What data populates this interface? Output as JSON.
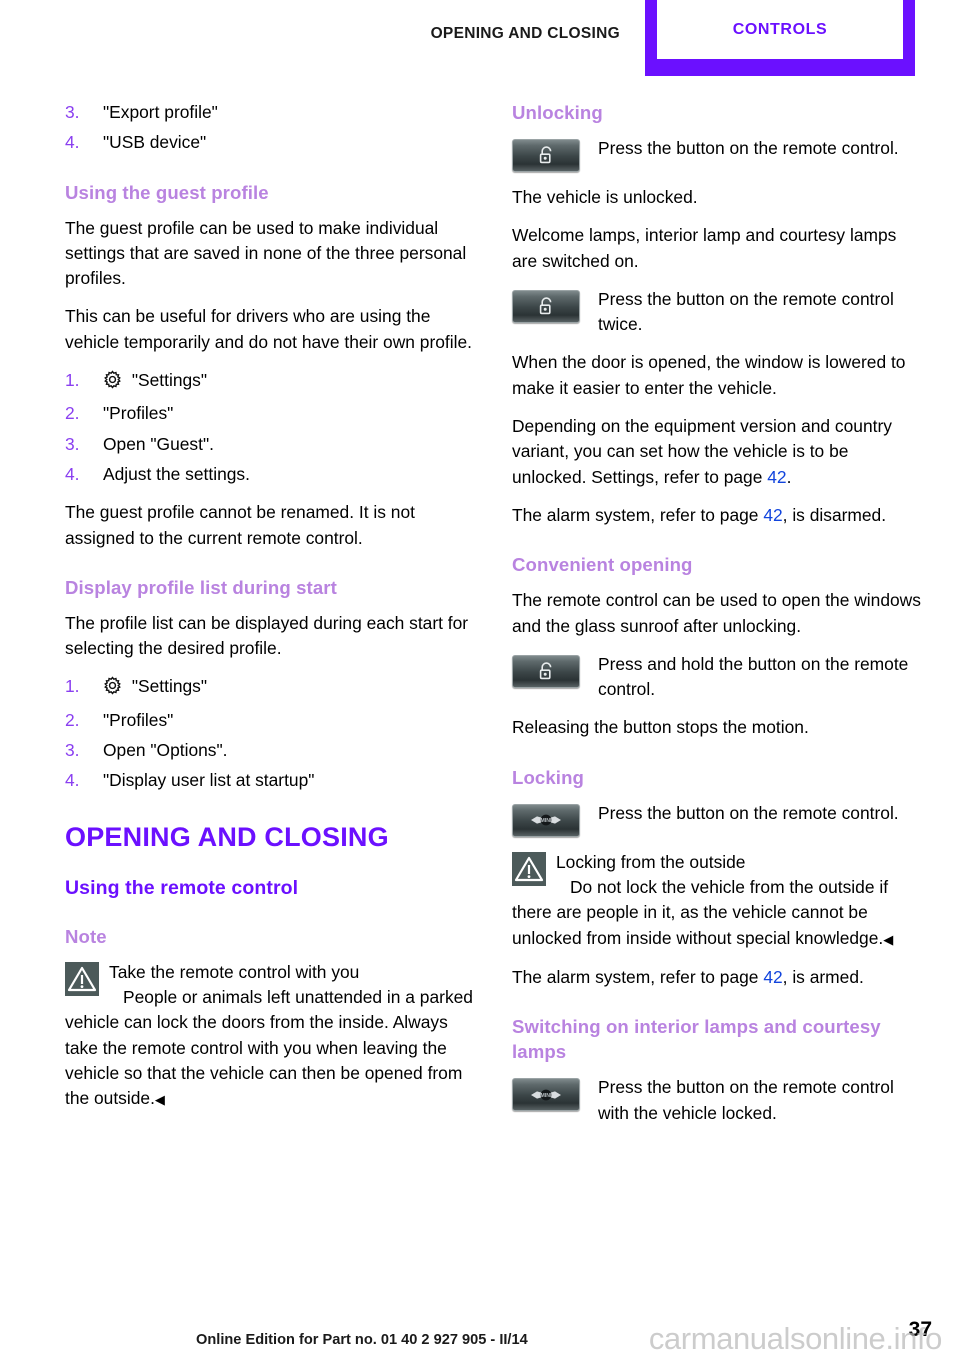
{
  "header": {
    "running_title": "OPENING AND CLOSING",
    "tab_label": "CONTROLS"
  },
  "colors": {
    "accent_purple": "#6b10ff",
    "accent_mauve": "#b983e0",
    "list_number_purple": "#8a3ff0",
    "page_ref_blue": "#1144dd",
    "icon_slate": "#4c5a5a"
  },
  "left_column": {
    "steps_continued": [
      {
        "num": "3.",
        "text": "\"Export profile\""
      },
      {
        "num": "4.",
        "text": "\"USB device\""
      }
    ],
    "guest_profile": {
      "heading": "Using the guest profile",
      "para1": "The guest profile can be used to make individual settings that are saved in none of the three personal profiles.",
      "para2": "This can be useful for drivers who are using the vehicle temporarily and do not have their own profile.",
      "steps": [
        {
          "num": "1.",
          "icon": "gear-icon",
          "text": "\"Settings\""
        },
        {
          "num": "2.",
          "icon": null,
          "text": "\"Profiles\""
        },
        {
          "num": "3.",
          "icon": null,
          "text": "Open \"Guest\"."
        },
        {
          "num": "4.",
          "icon": null,
          "text": "Adjust the settings."
        }
      ],
      "para3": "The guest profile cannot be renamed. It is not assigned to the current remote control."
    },
    "display_profile_list": {
      "heading": "Display profile list during start",
      "para1": "The profile list can be displayed during each start for selecting the desired profile.",
      "steps": [
        {
          "num": "1.",
          "icon": "gear-icon",
          "text": "\"Settings\""
        },
        {
          "num": "2.",
          "icon": null,
          "text": "\"Profiles\""
        },
        {
          "num": "3.",
          "icon": null,
          "text": "Open \"Options\"."
        },
        {
          "num": "4.",
          "icon": null,
          "text": "\"Display user list at startup\""
        }
      ]
    },
    "section": {
      "title": "OPENING AND CLOSING",
      "subtitle": "Using the remote control",
      "note_heading": "Note",
      "note_lead": "Take the remote control with you",
      "note_body": "People or animals left unattended in a parked vehicle can lock the doors from the inside. Always take the remote control with you when leaving the vehicle so that the vehicle can then be opened from the outside.",
      "note_endmark": "◀"
    }
  },
  "right_column": {
    "unlocking": {
      "heading": "Unlocking",
      "button1_icon": "unlock-padlock-icon",
      "button1_text": "Press the button on the remote control.",
      "para1": "The vehicle is unlocked.",
      "para2": "Welcome lamps, interior lamp and courtesy lamps are switched on.",
      "button2_icon": "unlock-padlock-icon",
      "button2_text": "Press the button on the remote control twice.",
      "para3": "When the door is opened, the window is lowered to make it easier to enter the vehicle.",
      "para4_a": "Depending on the equipment version and country variant, you can set how the vehicle is to be unlocked. Settings, refer to page ",
      "para4_ref": "42",
      "para4_b": ".",
      "para5_a": "The alarm system, refer to page ",
      "para5_ref": "42",
      "para5_b": ", is disarmed."
    },
    "convenient_opening": {
      "heading": "Convenient opening",
      "para1": "The remote control can be used to open the windows and the glass sunroof after unlocking.",
      "button_icon": "unlock-padlock-icon",
      "button_text": "Press and hold the button on the remote control.",
      "para2": "Releasing the button stops the motion."
    },
    "locking": {
      "heading": "Locking",
      "button_icon": "mini-logo-icon",
      "button_text": "Press the button on the remote control.",
      "warn_lead": "Locking from the outside",
      "warn_body": "Do not lock the vehicle from the outside if there are people in it, as the vehicle cannot be unlocked from inside without special knowledge.",
      "warn_endmark": "◀",
      "para_a": "The alarm system, refer to page ",
      "para_ref": "42",
      "para_b": ", is armed."
    },
    "interior_lamps": {
      "heading": "Switching on interior lamps and courtesy lamps",
      "button_icon": "mini-logo-icon",
      "button_text": "Press the button on the remote control with the vehicle locked."
    }
  },
  "footer": {
    "edition": "Online Edition for Part no. 01 40 2 927 905 - II/14",
    "page_number": "37",
    "watermark": "carmanualsonline.info"
  }
}
